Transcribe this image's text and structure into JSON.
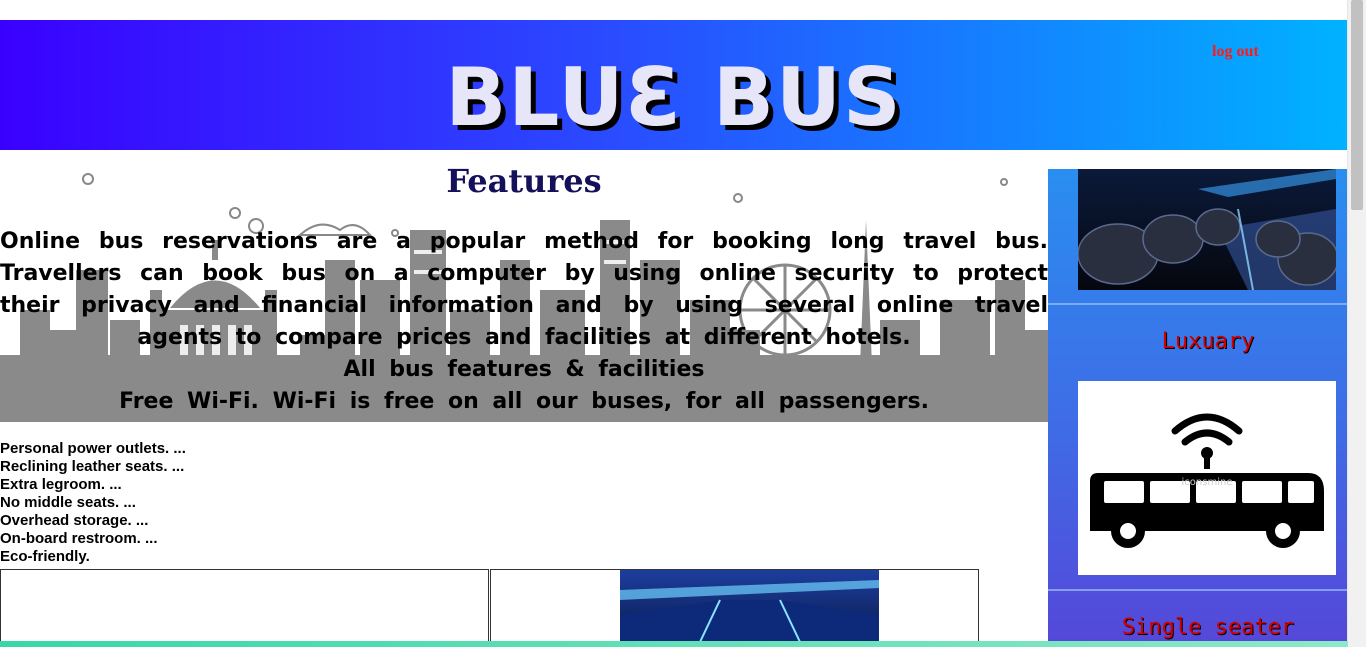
{
  "header": {
    "logo": "BLUƐ  BUS",
    "logout_label": "log out"
  },
  "main": {
    "title": "Features",
    "intro": "Online bus reservations are a popular method for booking long travel bus. Travellers can book bus on a computer by using online security to protect their privacy and financial information and by using several online travel agents to compare prices and facilities at different hotels.",
    "subtitle": "All bus features & facilities",
    "wifi_line": "Free Wi-Fi. Wi-Fi is free on all our buses, for all passengers.",
    "features": [
      "Personal power outlets. ...",
      "Reclining leather seats. ...",
      "Extra legroom. ...",
      "No middle seats. ...",
      "Overhead storage. ...",
      "On-board restroom. ...",
      "Eco-friendly."
    ]
  },
  "sidebar": {
    "labels": [
      "Luxuary",
      "Single  seater"
    ],
    "watermark": "iconsmine"
  },
  "colors": {
    "header_start": "#3a00ff",
    "header_end": "#00b2ff",
    "logo": "#e6e6f8",
    "logout": "#ff1a1a",
    "title": "#14105a",
    "sidebar_label": "#d10000"
  }
}
